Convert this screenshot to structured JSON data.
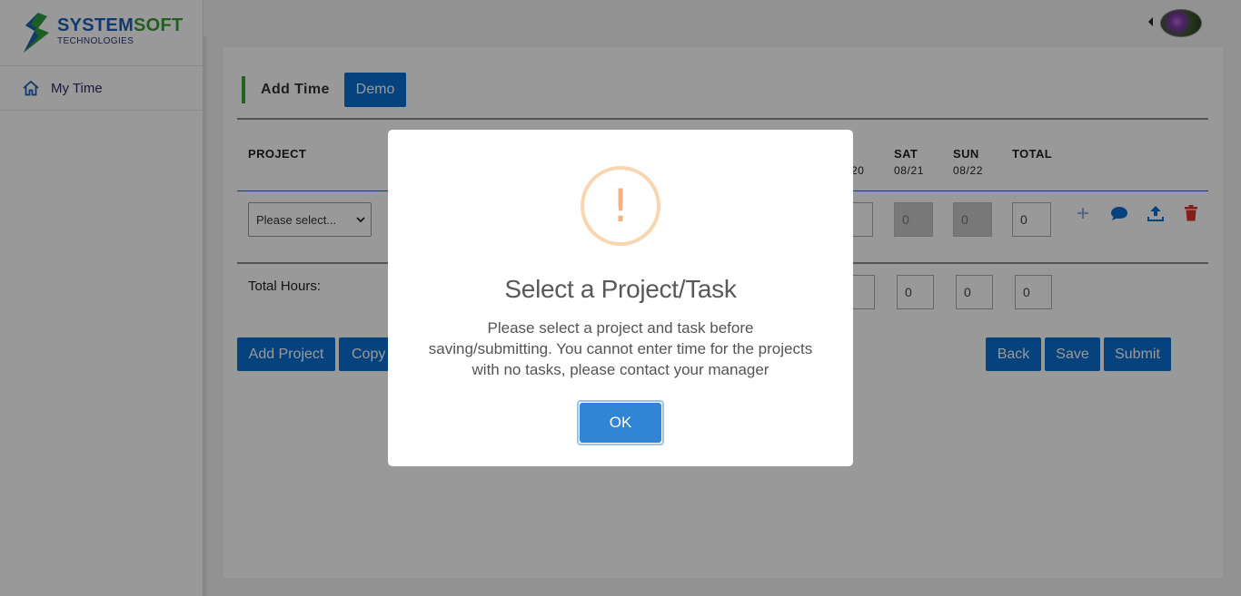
{
  "brand": {
    "name_part1": "SYSTEM",
    "name_part2": "SOFT",
    "subtitle": "TECHNOLOGIES"
  },
  "sidebar": {
    "items": [
      {
        "label": "My Time",
        "icon": "home-icon"
      }
    ]
  },
  "page": {
    "title": "Add Time",
    "badge_button": "Demo"
  },
  "table": {
    "project_header": "PROJECT",
    "day_columns": [
      {
        "day": "SAT",
        "date": "08/21"
      },
      {
        "day": "SUN",
        "date": "08/22"
      }
    ],
    "partial_date": "20",
    "total_header": "TOTAL",
    "row": {
      "project_select": "Please select...",
      "cell_values": [
        "0",
        "0",
        "0"
      ]
    },
    "total_hours_label": "Total Hours:",
    "total_values": [
      "0",
      "0",
      "0"
    ]
  },
  "actions": {
    "add_project": "Add Project",
    "copy": "Copy",
    "back": "Back",
    "save": "Save",
    "submit": "Submit"
  },
  "modal": {
    "icon": "!",
    "title": "Select a Project/Task",
    "message": "Please select a project and task before saving/submitting. You cannot enter time for the projects with no tasks, please contact your manager",
    "ok": "OK"
  },
  "colors": {
    "primary": "#0a6ed1",
    "accent_green": "#3fa03f",
    "delete_red": "#d9342b",
    "modal_ok": "#3085d6",
    "warning": "#f8bb86"
  }
}
